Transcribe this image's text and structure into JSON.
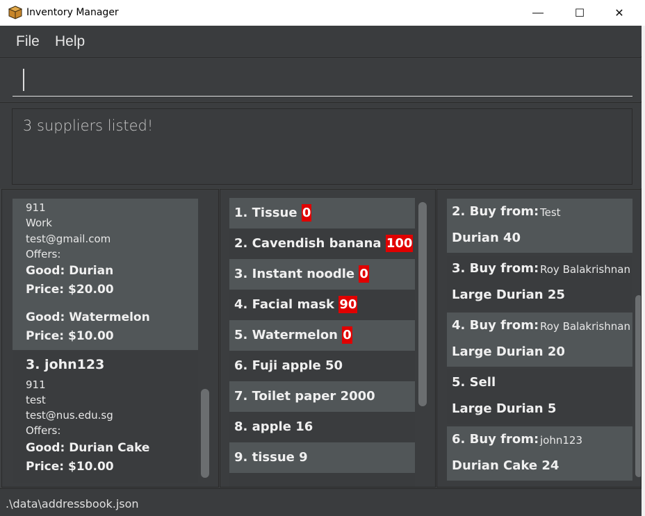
{
  "window": {
    "title": "Inventory Manager",
    "minimize": "—",
    "maximize": "☐",
    "close": "✕"
  },
  "menu": {
    "file": "File",
    "help": "Help"
  },
  "command": {
    "value": "",
    "placeholder": ""
  },
  "result": {
    "message": "3 suppliers listed!"
  },
  "suppliers": {
    "card_prev": {
      "phone": "911",
      "tag": "Work",
      "email": "test@gmail.com",
      "offers_label": "Offers:",
      "offers": [
        {
          "good": "Good: Durian",
          "price": "Price: $20.00"
        },
        {
          "good": "Good: Watermelon",
          "price": "Price: $10.00"
        }
      ]
    },
    "card_3": {
      "header": "3.  john123",
      "phone": "911",
      "tag": "test",
      "email": "test@nus.edu.sg",
      "offers_label": "Offers:",
      "offers": [
        {
          "good": "Good: Durian Cake",
          "price": "Price: $10.00"
        }
      ]
    }
  },
  "goods": [
    {
      "label": "1.  Tissue",
      "qty": "0",
      "low": true
    },
    {
      "label": "2.  Cavendish banana",
      "qty": "100",
      "low": true
    },
    {
      "label": "3.  Instant noodle",
      "qty": "0",
      "low": true
    },
    {
      "label": "4.  Facial mask",
      "qty": "90",
      "low": true
    },
    {
      "label": "5.  Watermelon",
      "qty": "0",
      "low": true
    },
    {
      "label": "6.  Fuji apple",
      "qty": "50",
      "low": false
    },
    {
      "label": "7.  Toilet paper",
      "qty": "2000",
      "low": false
    },
    {
      "label": "8.  apple",
      "qty": "16",
      "low": false
    },
    {
      "label": "9.  tissue",
      "qty": "9",
      "low": false
    }
  ],
  "transactions": [
    {
      "head": "2.  Buy from:",
      "supplier": "Test",
      "detail": "Durian 40"
    },
    {
      "head": "3.  Buy from:",
      "supplier": "Roy Balakrishnan",
      "detail": "Large Durian 25"
    },
    {
      "head": "4.  Buy from:",
      "supplier": "Roy Balakrishnan",
      "detail": "Large Durian 20"
    },
    {
      "head": "5.  Sell",
      "supplier": "",
      "detail": "Large Durian 5"
    },
    {
      "head": "6.  Buy from:",
      "supplier": "john123",
      "detail": "Durian Cake 24"
    }
  ],
  "status": {
    "path": ".\\data\\addressbook.json"
  },
  "colors": {
    "low_stock_badge": "#e00000",
    "card_highlight": "#515658",
    "background": "#3f4143"
  }
}
